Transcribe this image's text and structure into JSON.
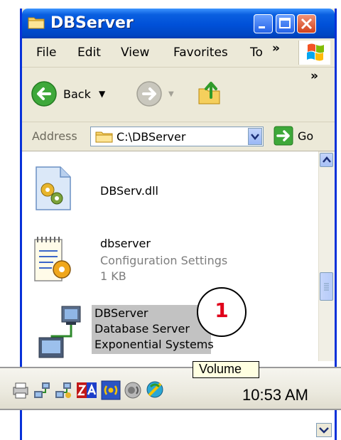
{
  "window": {
    "title": "DBServer",
    "buttons": {
      "minimize": "minimize-button",
      "maximize": "maximize-button",
      "close": "close-button"
    }
  },
  "menu": {
    "items": [
      {
        "label": "File"
      },
      {
        "label": "Edit"
      },
      {
        "label": "View"
      },
      {
        "label": "Favorites"
      },
      {
        "label": "To"
      }
    ],
    "overflow": "»"
  },
  "toolbar": {
    "back_label": "Back",
    "overflow": "»"
  },
  "address": {
    "label": "Address",
    "value": "C:\\DBServer",
    "go_label": "Go"
  },
  "files": [
    {
      "name": "DBServ.dll"
    },
    {
      "name": "dbserver",
      "type": "Configuration Settings",
      "size": "1 KB"
    },
    {
      "name": "DBServer",
      "type": "Database Server",
      "company": "Exponential Systems",
      "selected": true
    }
  ],
  "callout": {
    "number": "1"
  },
  "taskbar": {
    "clock": "10:53 AM",
    "tooltip": "Volume",
    "tray_icons": [
      "printer-icon",
      "network-icon",
      "network-icon",
      "zonealarm-icon",
      "wireless-icon",
      "volume-icon",
      "connection-icon"
    ]
  },
  "colors": {
    "title_blue": "#0050d8",
    "selection_gray": "#c2c2c2",
    "callout_red": "#e0001a",
    "tooltip_bg": "#ffffe1"
  }
}
